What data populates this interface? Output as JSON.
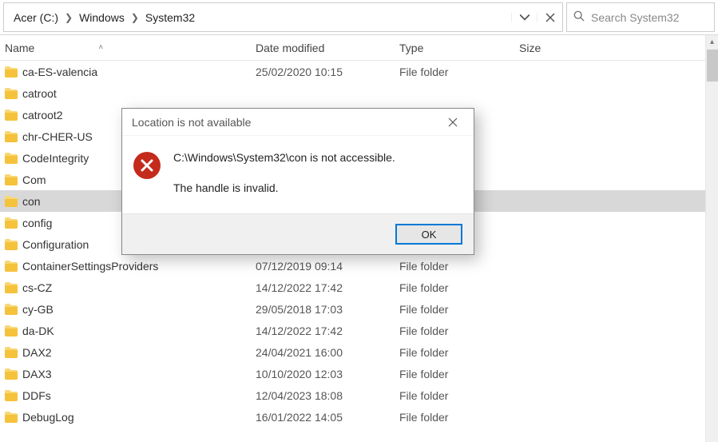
{
  "breadcrumb": {
    "crumb0": "Acer (C:)",
    "crumb1": "Windows",
    "crumb2": "System32"
  },
  "search": {
    "placeholder": "Search System32"
  },
  "columns": {
    "name": "Name",
    "date": "Date modified",
    "type": "Type",
    "size": "Size"
  },
  "rows": [
    {
      "name": "ca-ES-valencia",
      "date": "25/02/2020 10:15",
      "type": "File folder",
      "selected": false
    },
    {
      "name": "catroot",
      "date": "",
      "type": "",
      "selected": false
    },
    {
      "name": "catroot2",
      "date": "",
      "type": "",
      "selected": false
    },
    {
      "name": "chr-CHER-US",
      "date": "",
      "type": "",
      "selected": false
    },
    {
      "name": "CodeIntegrity",
      "date": "",
      "type": "",
      "selected": false
    },
    {
      "name": "Com",
      "date": "",
      "type": "",
      "selected": false
    },
    {
      "name": "con",
      "date": "",
      "type": "",
      "selected": true
    },
    {
      "name": "config",
      "date": "",
      "type": "",
      "selected": false
    },
    {
      "name": "Configuration",
      "date": "",
      "type": "",
      "selected": false
    },
    {
      "name": "ContainerSettingsProviders",
      "date": "07/12/2019 09:14",
      "type": "File folder",
      "selected": false
    },
    {
      "name": "cs-CZ",
      "date": "14/12/2022 17:42",
      "type": "File folder",
      "selected": false
    },
    {
      "name": "cy-GB",
      "date": "29/05/2018 17:03",
      "type": "File folder",
      "selected": false
    },
    {
      "name": "da-DK",
      "date": "14/12/2022 17:42",
      "type": "File folder",
      "selected": false
    },
    {
      "name": "DAX2",
      "date": "24/04/2021 16:00",
      "type": "File folder",
      "selected": false
    },
    {
      "name": "DAX3",
      "date": "10/10/2020 12:03",
      "type": "File folder",
      "selected": false
    },
    {
      "name": "DDFs",
      "date": "12/04/2023 18:08",
      "type": "File folder",
      "selected": false
    },
    {
      "name": "DebugLog",
      "date": "16/01/2022 14:05",
      "type": "File folder",
      "selected": false
    }
  ],
  "dialog": {
    "title": "Location is not available",
    "line1": "C:\\Windows\\System32\\con is not accessible.",
    "line2": "The handle is invalid.",
    "ok": "OK"
  }
}
